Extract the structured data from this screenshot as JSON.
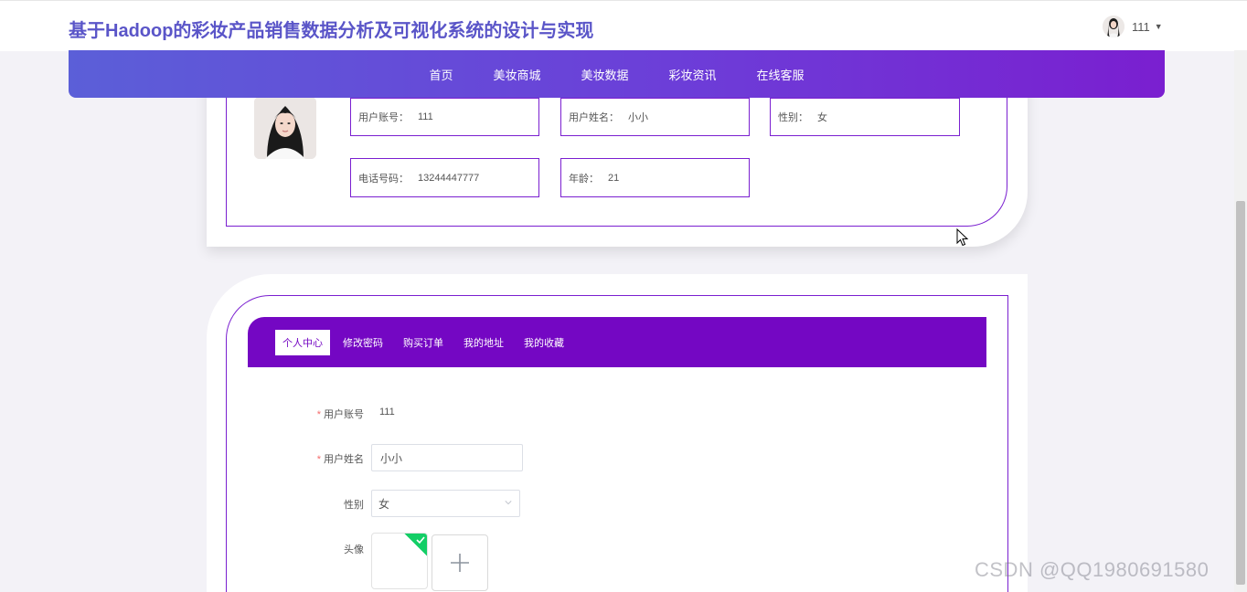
{
  "header": {
    "site_title": "基于Hadoop的彩妆产品销售数据分析及可视化系统的设计与实现",
    "user": {
      "name": "111",
      "avatar_icon": "user-avatar",
      "dropdown_icon": "caret-down-icon"
    }
  },
  "nav": {
    "items": [
      {
        "label": "首页"
      },
      {
        "label": "美妆商城"
      },
      {
        "label": "美妆数据"
      },
      {
        "label": "彩妆资讯"
      },
      {
        "label": "在线客服"
      }
    ]
  },
  "profile_card": {
    "photo_icon": "profile-photo",
    "fields": [
      {
        "key": "用户账号：",
        "value": "111"
      },
      {
        "key": "用户姓名：",
        "value": "小小"
      },
      {
        "key": "性别：",
        "value": "女"
      },
      {
        "key": "电话号码：",
        "value": "13244447777"
      },
      {
        "key": "年龄：",
        "value": "21"
      }
    ]
  },
  "tabs": [
    {
      "label": "个人中心",
      "active": true
    },
    {
      "label": "修改密码",
      "active": false
    },
    {
      "label": "购买订单",
      "active": false
    },
    {
      "label": "我的地址",
      "active": false
    },
    {
      "label": "我的收藏",
      "active": false
    }
  ],
  "form": {
    "account": {
      "label": "用户账号",
      "required": "*",
      "value": "111"
    },
    "name": {
      "label": "用户姓名",
      "required": "*",
      "value": "小小"
    },
    "gender": {
      "label": "性别",
      "value": "女"
    },
    "avatar": {
      "label": "头像",
      "add_icon": "plus-icon",
      "uploaded_badge_icon": "check-icon"
    }
  },
  "watermark": "CSDN @QQ1980691580",
  "colors": {
    "brand": "#5a55c8",
    "accent_purple": "#7407c3",
    "required_red": "#f56c6c",
    "success_green": "#13ce66"
  }
}
